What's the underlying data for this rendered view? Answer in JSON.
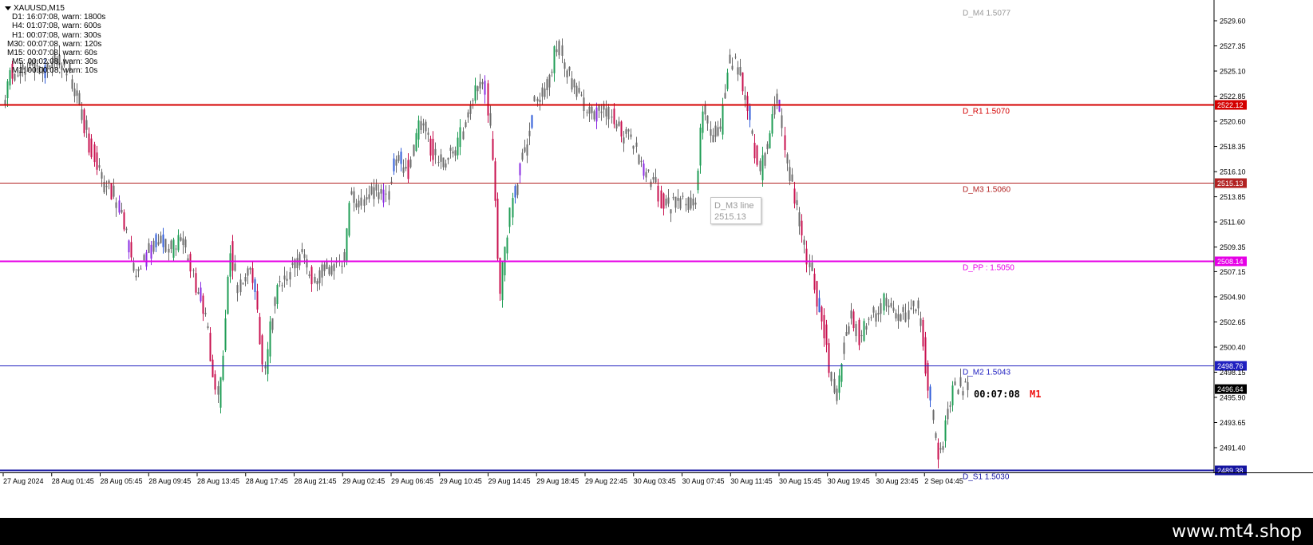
{
  "symbol_title": "XAUUSD,M15",
  "timeframe_rows": [
    "D1: 16:07:08, warn: 1800s",
    "H4: 01:07:08, warn: 600s",
    "H1: 00:07:08, warn: 300s",
    "M30: 00:07:08, warn: 120s",
    "M15: 00:07:08, warn: 60s",
    "M5: 00:02:08, warn: 30s",
    "M1: 00:00:08, warn: 10s"
  ],
  "price_axis_ticks": [
    "2529.60",
    "2527.35",
    "2525.10",
    "2522.85",
    "2520.60",
    "2518.35",
    "2516.10",
    "2513.85",
    "2511.60",
    "2509.35",
    "2507.15",
    "2504.90",
    "2502.65",
    "2500.40",
    "2498.15",
    "2495.90",
    "2493.65",
    "2491.40"
  ],
  "time_axis_labels": [
    "27 Aug 2024",
    "28 Aug 01:45",
    "28 Aug 05:45",
    "28 Aug 09:45",
    "28 Aug 13:45",
    "28 Aug 17:45",
    "28 Aug 21:45",
    "29 Aug 02:45",
    "29 Aug 06:45",
    "29 Aug 10:45",
    "29 Aug 14:45",
    "29 Aug 18:45",
    "29 Aug 22:45",
    "30 Aug 03:45",
    "30 Aug 07:45",
    "30 Aug 11:45",
    "30 Aug 15:45",
    "30 Aug 19:45",
    "30 Aug 23:45",
    "2 Sep 04:45"
  ],
  "levels": [
    {
      "name": "D_M4 1.5077",
      "price": 2530.9,
      "color": "#9a9a9a",
      "width": 0,
      "tag": ""
    },
    {
      "name": "D_R1 1.5070",
      "price": 2522.12,
      "color": "#d40000",
      "width": 2,
      "tag": "2522.12"
    },
    {
      "name": "D_M3 1.5060",
      "price": 2515.13,
      "color": "#b22222",
      "width": 1,
      "tag": "2515.13"
    },
    {
      "name": "D_PP : 1.5050",
      "price": 2508.14,
      "color": "#e600e6",
      "width": 2,
      "tag": "2508.14"
    },
    {
      "name": "D_M2 1.5043",
      "price": 2498.76,
      "color": "#2020c0",
      "width": 1,
      "tag": "2498.76"
    },
    {
      "name": "D_S1 1.5030",
      "price": 2489.38,
      "color": "#1414a0",
      "width": 2,
      "tag": "2489.38"
    }
  ],
  "current_price": "2496.64",
  "tooltip": {
    "line1": "D_M3 line",
    "line2": "2515.13"
  },
  "countdown": "00:07:08",
  "period_label": "M1",
  "watermark": "www.mt4.shop",
  "colors": {
    "candle": "#6b6b6b",
    "bull_strong": "#1f9d55",
    "bear_strong": "#c8114f",
    "violet": "#8a2be2",
    "blue": "#2f5bd8"
  },
  "chart_data": {
    "type": "candlestick",
    "title": "XAUUSD,M15",
    "ylim": [
      2489.0,
      2531.0
    ],
    "path_points": [
      [
        0,
        2519.5
      ],
      [
        8,
        2522.0
      ],
      [
        15,
        2525.3
      ],
      [
        25,
        2524.4
      ],
      [
        40,
        2525.8
      ],
      [
        55,
        2524.8
      ],
      [
        72,
        2526.2
      ],
      [
        88,
        2525.0
      ],
      [
        100,
        2522.5
      ],
      [
        108,
        2520.0
      ],
      [
        118,
        2517.8
      ],
      [
        130,
        2515.2
      ],
      [
        145,
        2514.0
      ],
      [
        160,
        2511.0
      ],
      [
        172,
        2507.0
      ],
      [
        185,
        2508.6
      ],
      [
        200,
        2510.0
      ],
      [
        215,
        2509.0
      ],
      [
        230,
        2510.2
      ],
      [
        245,
        2506.5
      ],
      [
        260,
        2503.0
      ],
      [
        270,
        2498.0
      ],
      [
        276,
        2495.5
      ],
      [
        282,
        2500.0
      ],
      [
        290,
        2509.8
      ],
      [
        300,
        2505.5
      ],
      [
        315,
        2508.5
      ],
      [
        325,
        2504.0
      ],
      [
        333,
        2497.0
      ],
      [
        340,
        2502.0
      ],
      [
        352,
        2506.5
      ],
      [
        365,
        2507.0
      ],
      [
        380,
        2508.8
      ],
      [
        395,
        2506.0
      ],
      [
        410,
        2507.6
      ],
      [
        425,
        2507.3
      ],
      [
        435,
        2508.3
      ],
      [
        440,
        2514.0
      ],
      [
        455,
        2512.8
      ],
      [
        470,
        2514.2
      ],
      [
        485,
        2514.0
      ],
      [
        500,
        2517.5
      ],
      [
        515,
        2516.0
      ],
      [
        525,
        2519.8
      ],
      [
        535,
        2520.4
      ],
      [
        545,
        2517.5
      ],
      [
        560,
        2517.0
      ],
      [
        575,
        2518.2
      ],
      [
        587,
        2521.5
      ],
      [
        597,
        2523.0
      ],
      [
        610,
        2523.8
      ],
      [
        622,
        2516.0
      ],
      [
        628,
        2504.5
      ],
      [
        635,
        2509.0
      ],
      [
        645,
        2514.0
      ],
      [
        660,
        2518.0
      ],
      [
        670,
        2522.0
      ],
      [
        680,
        2523.0
      ],
      [
        690,
        2524.5
      ],
      [
        700,
        2527.3
      ],
      [
        710,
        2525.8
      ],
      [
        720,
        2524.0
      ],
      [
        735,
        2522.0
      ],
      [
        750,
        2521.3
      ],
      [
        765,
        2521.6
      ],
      [
        780,
        2519.6
      ],
      [
        795,
        2518.8
      ],
      [
        805,
        2516.8
      ],
      [
        815,
        2516.0
      ],
      [
        830,
        2513.6
      ],
      [
        845,
        2513.0
      ],
      [
        860,
        2513.2
      ],
      [
        875,
        2513.8
      ],
      [
        882,
        2522.5
      ],
      [
        892,
        2519.0
      ],
      [
        905,
        2520.0
      ],
      [
        915,
        2526.0
      ],
      [
        925,
        2525.8
      ],
      [
        935,
        2523.0
      ],
      [
        945,
        2519.0
      ],
      [
        955,
        2516.0
      ],
      [
        965,
        2519.0
      ],
      [
        975,
        2523.5
      ],
      [
        985,
        2518.5
      ],
      [
        995,
        2514.5
      ],
      [
        1005,
        2511.0
      ],
      [
        1015,
        2508.0
      ],
      [
        1025,
        2505.0
      ],
      [
        1035,
        2502.0
      ],
      [
        1045,
        2497.0
      ],
      [
        1052,
        2496.0
      ],
      [
        1060,
        2501.0
      ],
      [
        1070,
        2503.5
      ],
      [
        1080,
        2501.0
      ],
      [
        1090,
        2503.0
      ],
      [
        1100,
        2503.4
      ],
      [
        1110,
        2504.5
      ],
      [
        1120,
        2503.8
      ],
      [
        1130,
        2503.2
      ],
      [
        1140,
        2503.5
      ],
      [
        1148,
        2504.6
      ],
      [
        1155,
        2503.0
      ],
      [
        1162,
        2499.0
      ],
      [
        1170,
        2494.0
      ],
      [
        1178,
        2491.0
      ],
      [
        1185,
        2492.5
      ],
      [
        1192,
        2495.5
      ],
      [
        1200,
        2497.0
      ],
      [
        1210,
        2496.8
      ]
    ]
  }
}
